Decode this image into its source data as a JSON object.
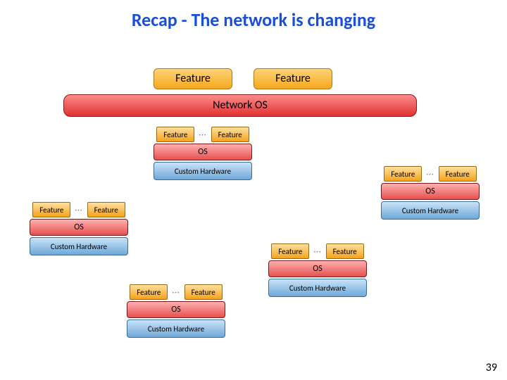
{
  "title": "Recap - The network is changing",
  "big_feature": "Feature",
  "network_os": "Network OS",
  "stack": {
    "feature": "Feature",
    "dots": "···",
    "os": "OS",
    "hw": "Custom Hardware"
  },
  "pagenum": "39"
}
